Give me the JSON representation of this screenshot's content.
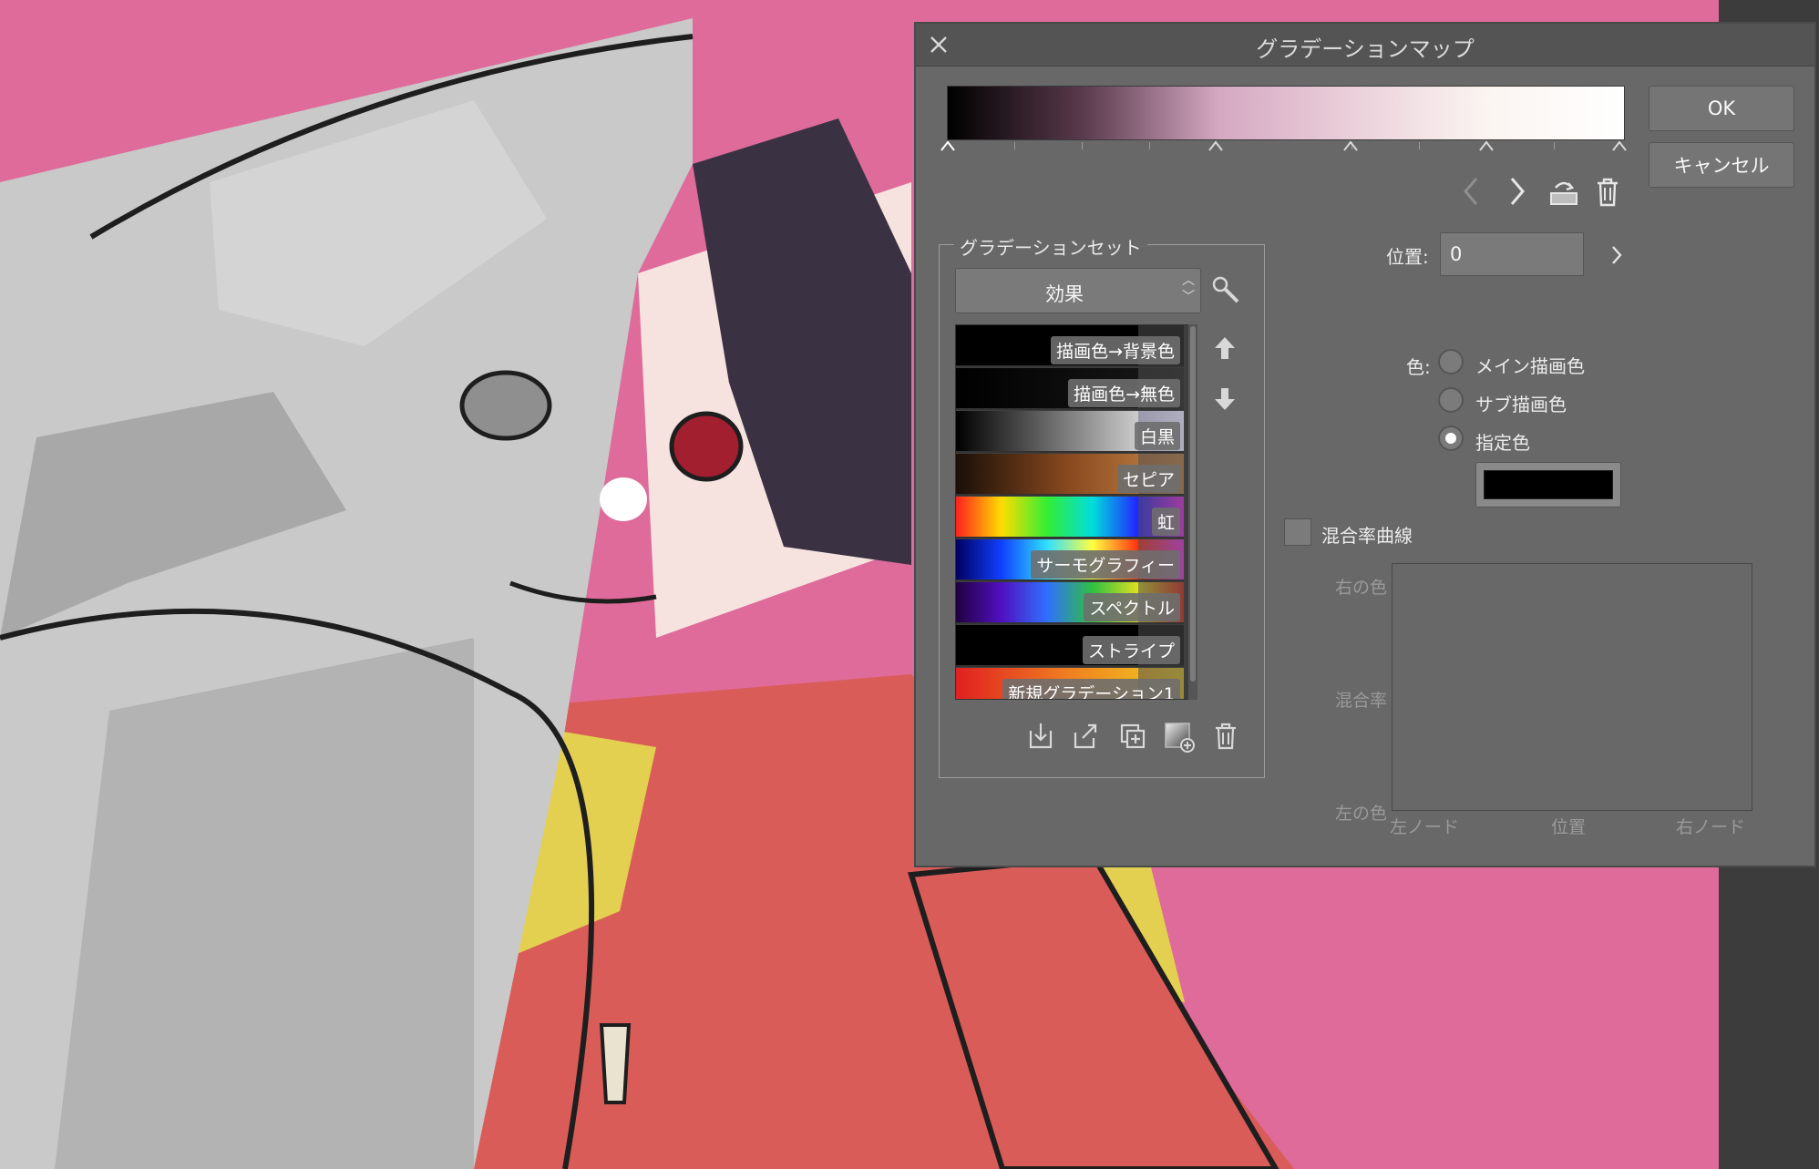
{
  "dialog": {
    "title": "グラデーションマップ",
    "ok_label": "OK",
    "cancel_label": "キャンセル",
    "gradient_stops": [
      "#000000",
      "#5a3a4c",
      "#d4a8c2",
      "#ebd0da",
      "#fbf5f1",
      "#ffffff"
    ]
  },
  "gradient_set": {
    "legend": "グラデーションセット",
    "selected": "効果",
    "items": [
      {
        "label": "描画色→背景色"
      },
      {
        "label": "描画色→無色"
      },
      {
        "label": "白黒"
      },
      {
        "label": "セピア"
      },
      {
        "label": "虹"
      },
      {
        "label": "サーモグラフィー"
      },
      {
        "label": "スペクトル"
      },
      {
        "label": "ストライプ"
      },
      {
        "label": "新規グラデーション1"
      }
    ]
  },
  "position": {
    "label": "位置:",
    "value": "0"
  },
  "color": {
    "label": "色:",
    "options": [
      "メイン描画色",
      "サブ描画色",
      "指定色"
    ],
    "selected": "指定色",
    "specified_color": "#000000"
  },
  "curve": {
    "checkbox_label": "混合率曲線",
    "y_top": "右の色",
    "y_mid": "混合率",
    "y_bottom": "左の色",
    "x_left": "左ノード",
    "x_mid": "位置",
    "x_right": "右ノード"
  }
}
